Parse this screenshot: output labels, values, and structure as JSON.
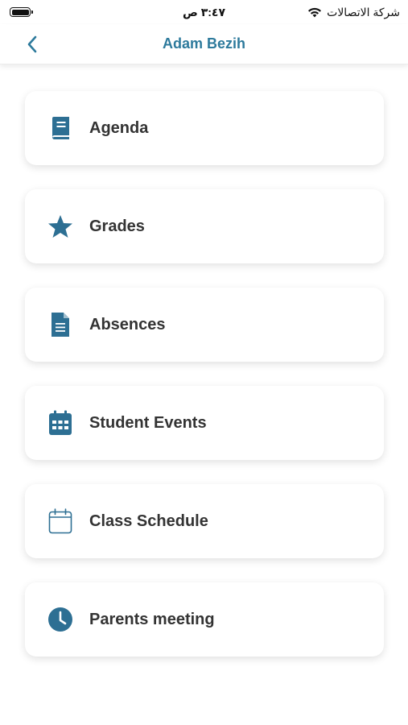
{
  "status_bar": {
    "carrier": "شركة الاتصالات",
    "time": "٣:٤٧ ص"
  },
  "nav": {
    "title": "Adam Bezih",
    "back_icon": "chevron-left-icon"
  },
  "colors": {
    "accent": "#2d7a9c",
    "icon": "#2d6f93",
    "card_bg": "#ffffff",
    "label": "#333333"
  },
  "menu": {
    "items": [
      {
        "label": "Agenda",
        "icon": "book-icon"
      },
      {
        "label": "Grades",
        "icon": "star-icon"
      },
      {
        "label": "Absences",
        "icon": "document-icon"
      },
      {
        "label": "Student Events",
        "icon": "calendar-grid-icon"
      },
      {
        "label": "Class Schedule",
        "icon": "calendar-outline-icon"
      },
      {
        "label": "Parents meeting",
        "icon": "clock-icon"
      }
    ]
  }
}
